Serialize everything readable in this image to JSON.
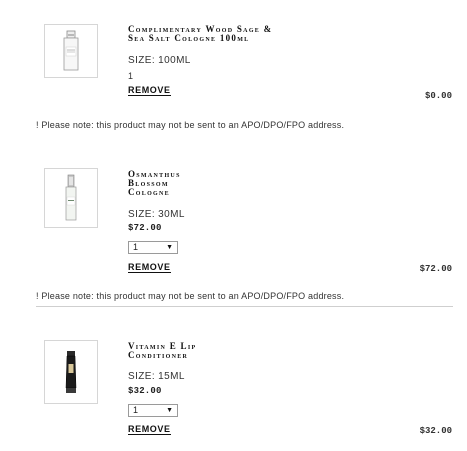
{
  "items": [
    {
      "name_lines": [
        "Complimentary Wood Sage &",
        "Sea Salt Cologne 100ml"
      ],
      "image_icon": "cologne-bottle-icon",
      "size": "SIZE: 100ML",
      "quantity": "1",
      "remove_label": "REMOVE",
      "line_total": "$0.00"
    },
    {
      "name_lines": [
        "Osmanthus",
        "Blossom",
        "Cologne"
      ],
      "image_icon": "cologne-bottle-slim-icon",
      "size": "SIZE: 30ML",
      "unit_price": "$72.00",
      "quantity": "1",
      "remove_label": "REMOVE",
      "line_total": "$72.00"
    },
    {
      "name_lines": [
        "Vitamin E Lip",
        "Conditioner"
      ],
      "image_icon": "lip-tube-icon",
      "size": "SIZE: 15ML",
      "unit_price": "$32.00",
      "quantity": "1",
      "remove_label": "REMOVE",
      "line_total": "$32.00"
    }
  ],
  "notes": [
    "! Please note: this product may not be sent to an APO/DPO/FPO address.",
    "! Please note: this product may not be sent to an APO/DPO/FPO address."
  ]
}
